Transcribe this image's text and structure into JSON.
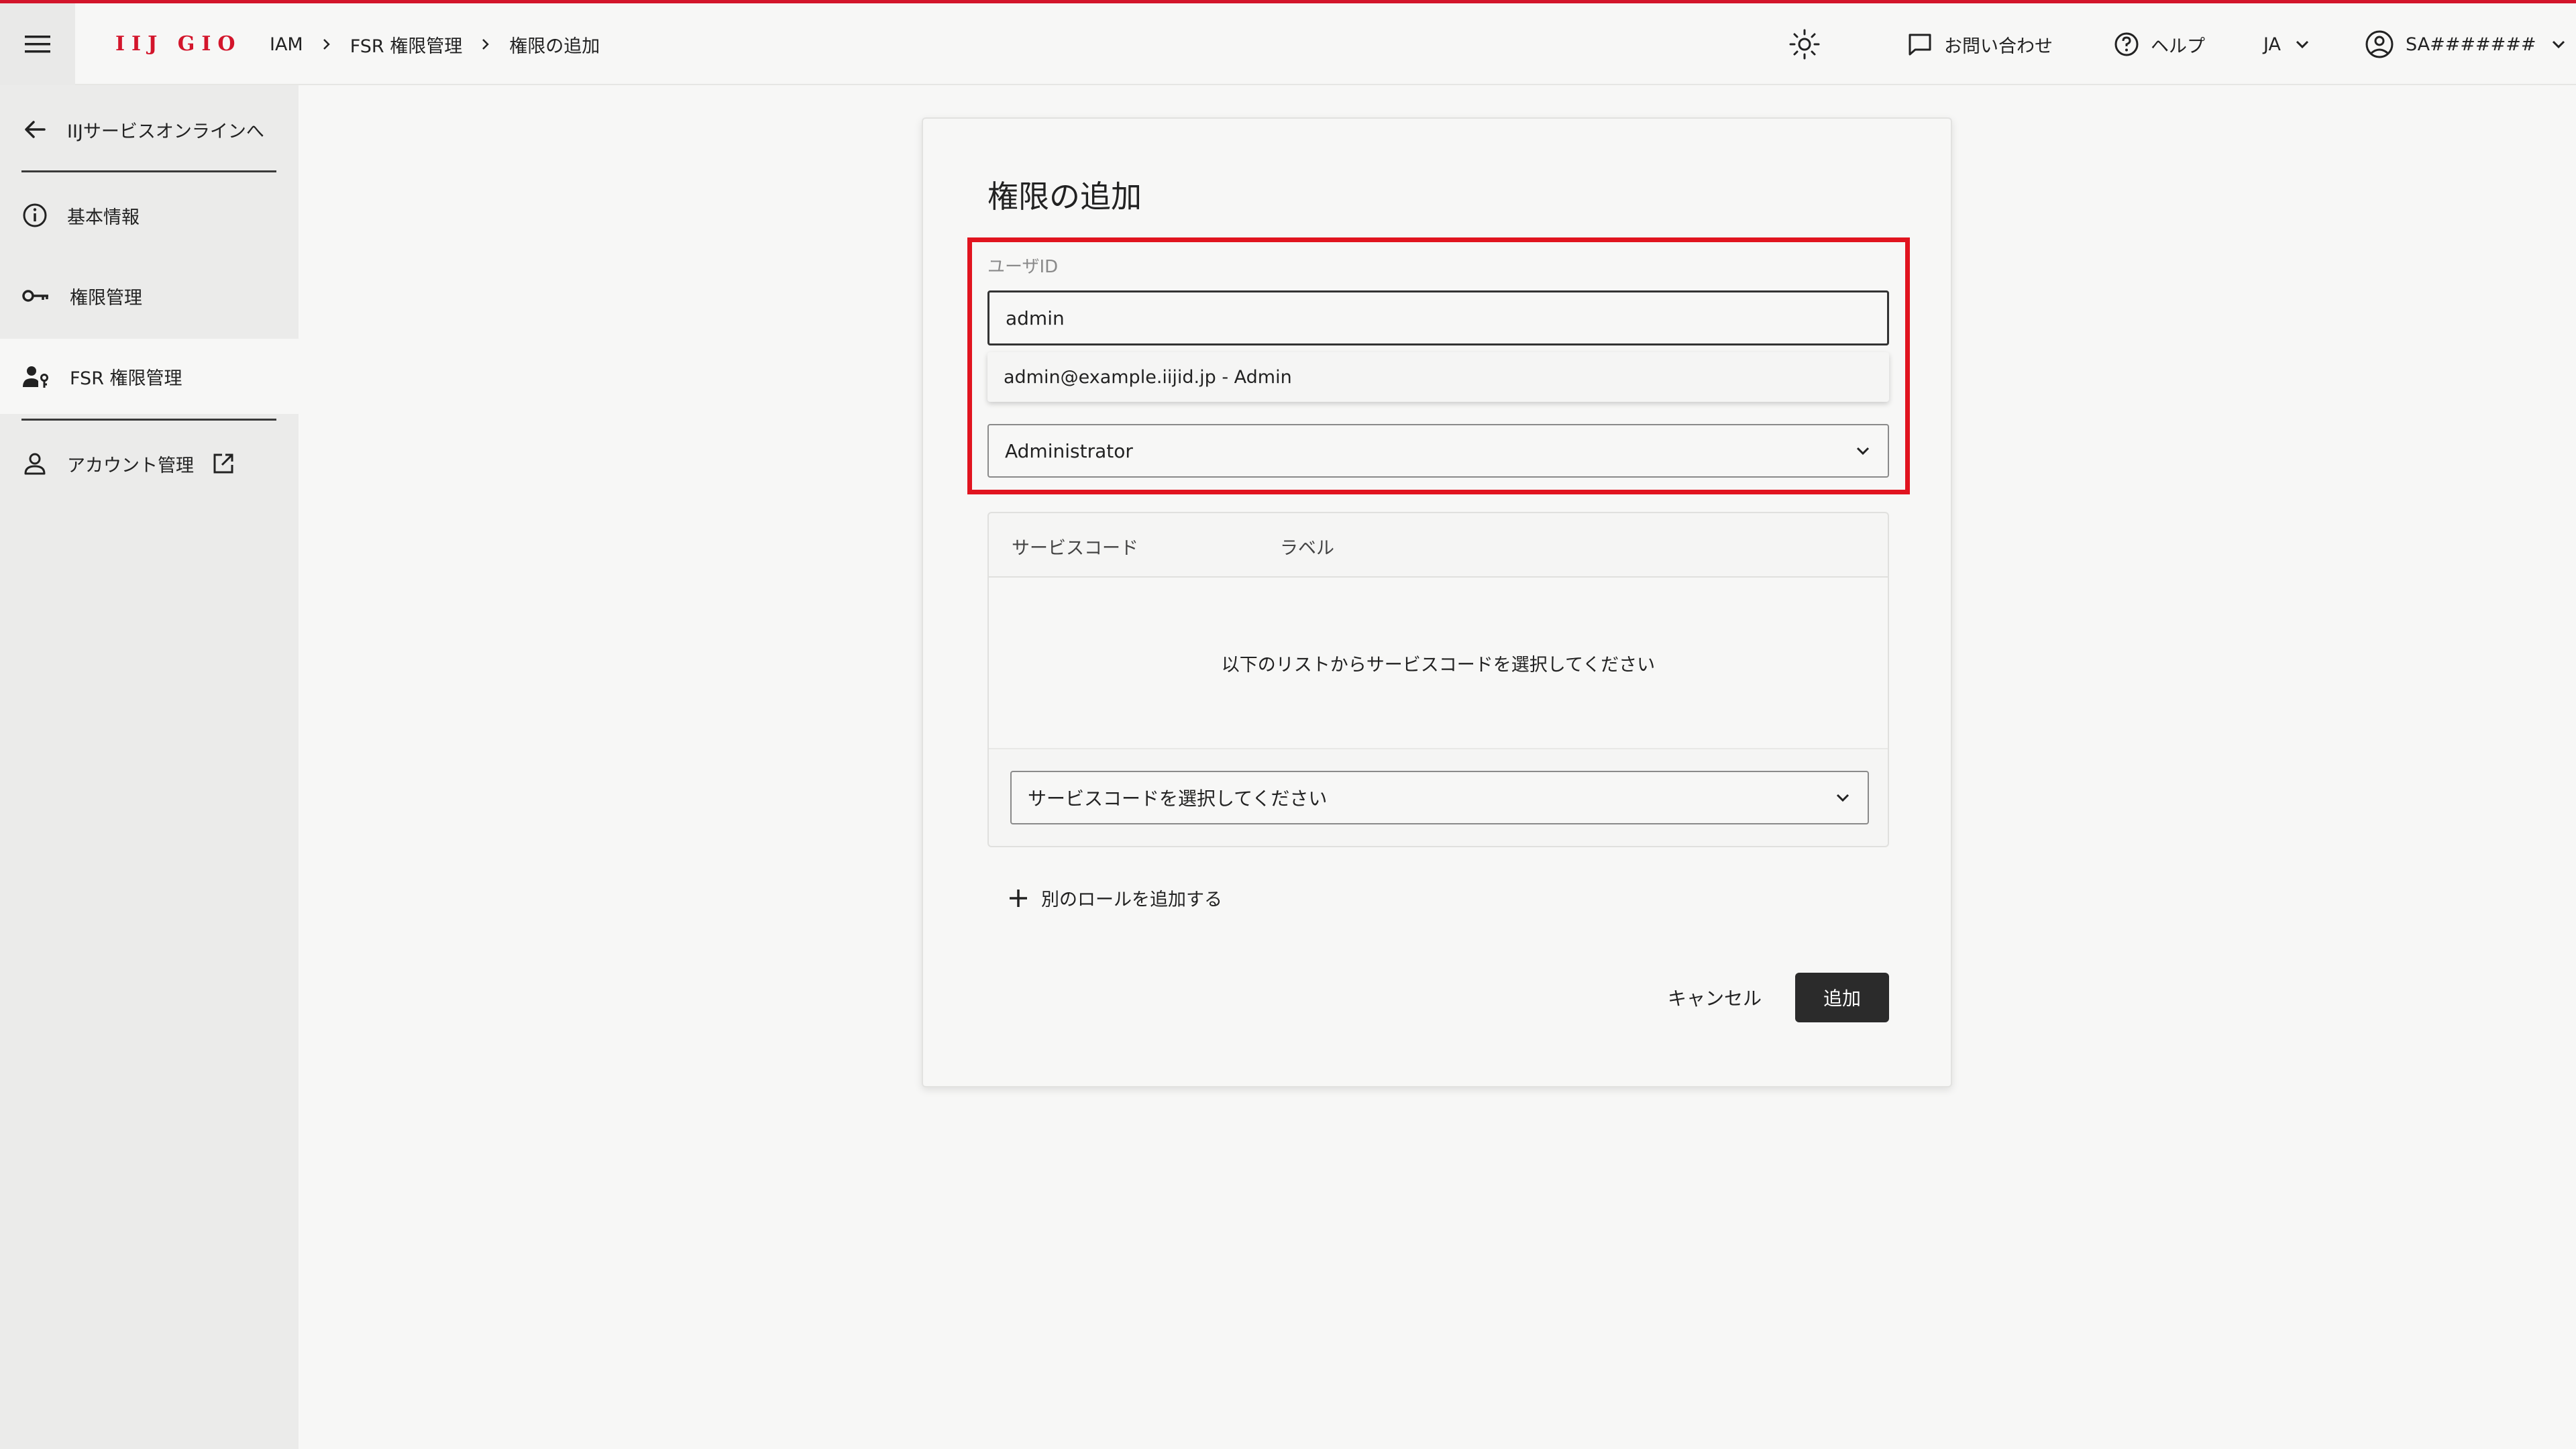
{
  "header": {
    "logo": "IIJ GIO",
    "breadcrumb": [
      "IAM",
      "FSR 権限管理",
      "権限の追加"
    ],
    "contact": "お問い合わせ",
    "help": "ヘルプ",
    "lang": "JA",
    "user": "SA#######"
  },
  "sidebar": {
    "back": "IIJサービスオンラインへ",
    "items": [
      {
        "label": "基本情報"
      },
      {
        "label": "権限管理"
      },
      {
        "label": "FSR 権限管理"
      },
      {
        "label": "アカウント管理"
      }
    ]
  },
  "form": {
    "title": "権限の追加",
    "user_id_label": "ユーザID",
    "user_id_value": "admin",
    "suggestion": "admin@example.iijid.jp - Admin",
    "role_value": "Administrator",
    "table": {
      "col_service_code": "サービスコード",
      "col_label": "ラベル",
      "empty_message": "以下のリストからサービスコードを選択してください"
    },
    "service_select_placeholder": "サービスコードを選択してください",
    "add_role": "別のロールを追加する",
    "cancel": "キャンセル",
    "submit": "追加"
  },
  "colors": {
    "brand": "#d3152b",
    "highlight": "#e1141f",
    "primary_button": "#2b2b2b"
  }
}
